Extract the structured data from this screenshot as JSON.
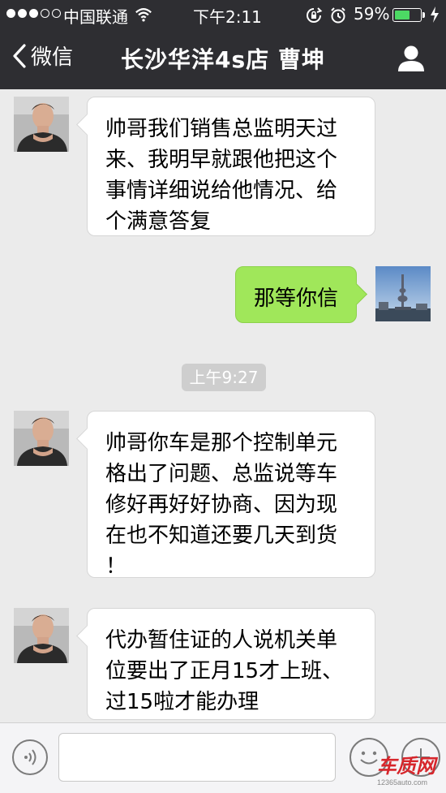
{
  "status_bar": {
    "carrier": "中国联通",
    "time": "下午2:11",
    "battery": "59%",
    "battery_level": 0.59,
    "signal_bars": 3,
    "signal_max": 5,
    "icons": [
      "wifi-icon",
      "rotation-lock-icon",
      "alarm-icon",
      "battery-icon",
      "charging-icon"
    ]
  },
  "nav": {
    "back_label": "微信",
    "title": "长沙华洋4s店 曹坤",
    "back_icon": "chevron-left-icon",
    "profile_icon": "person-icon"
  },
  "messages": [
    {
      "side": "left",
      "text": "帅哥我们销售总监明天过\n来、我明早就跟他把这个\n事情详细说给他情况、给\n个满意答复"
    },
    {
      "side": "right",
      "text": "那等你信"
    },
    {
      "side": "left",
      "text": "帅哥你车是那个控制单元\n格出了问题、总监说等车\n修好再好好协商、因为现\n在也不知道还要几天到货\n！"
    },
    {
      "side": "left",
      "text": "代办暂住证的人说机关单\n位要出了正月15才上班、\n过15啦才能办理"
    }
  ],
  "time_divider": "上午9:27",
  "input_bar": {
    "icons": [
      "voice-icon",
      "emoji-icon",
      "plus-icon"
    ]
  },
  "watermark": {
    "main": "车质网",
    "url": "12365auto.com"
  },
  "colors": {
    "topbar": "#2e2e32",
    "background": "#ebebeb",
    "outgoing_bubble": "#a0e75a",
    "incoming_bubble": "#ffffff",
    "battery_fill": "#4cd964"
  }
}
